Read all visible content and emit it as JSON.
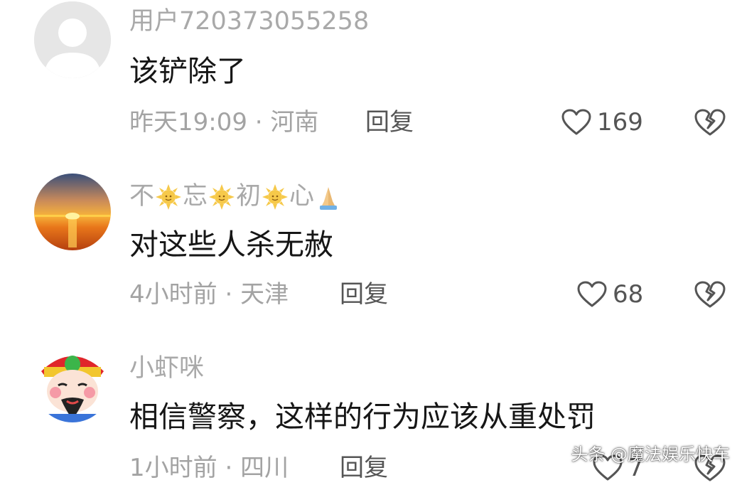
{
  "comments": [
    {
      "username": "用户720373055258",
      "text": "该铲除了",
      "time": "昨天19:09",
      "separator": "·",
      "location": "河南",
      "reply_label": "回复",
      "likes": "169"
    },
    {
      "username_parts": [
        "不",
        "忘",
        "初",
        "心"
      ],
      "text": "对这些人杀无赦",
      "time": "4小时前",
      "separator": "·",
      "location": "天津",
      "reply_label": "回复",
      "likes": "68"
    },
    {
      "username": "小虾咪",
      "text": "相信警察，这样的行为应该从重处罚",
      "time": "1小时前",
      "separator": "·",
      "location": "四川",
      "reply_label": "回复",
      "likes": "7"
    }
  ],
  "watermark": "头条 @魔法娱乐快车",
  "colors": {
    "meta_gray": "#a3a3a3",
    "text_dark": "#161616",
    "icon_gray": "#555555"
  }
}
